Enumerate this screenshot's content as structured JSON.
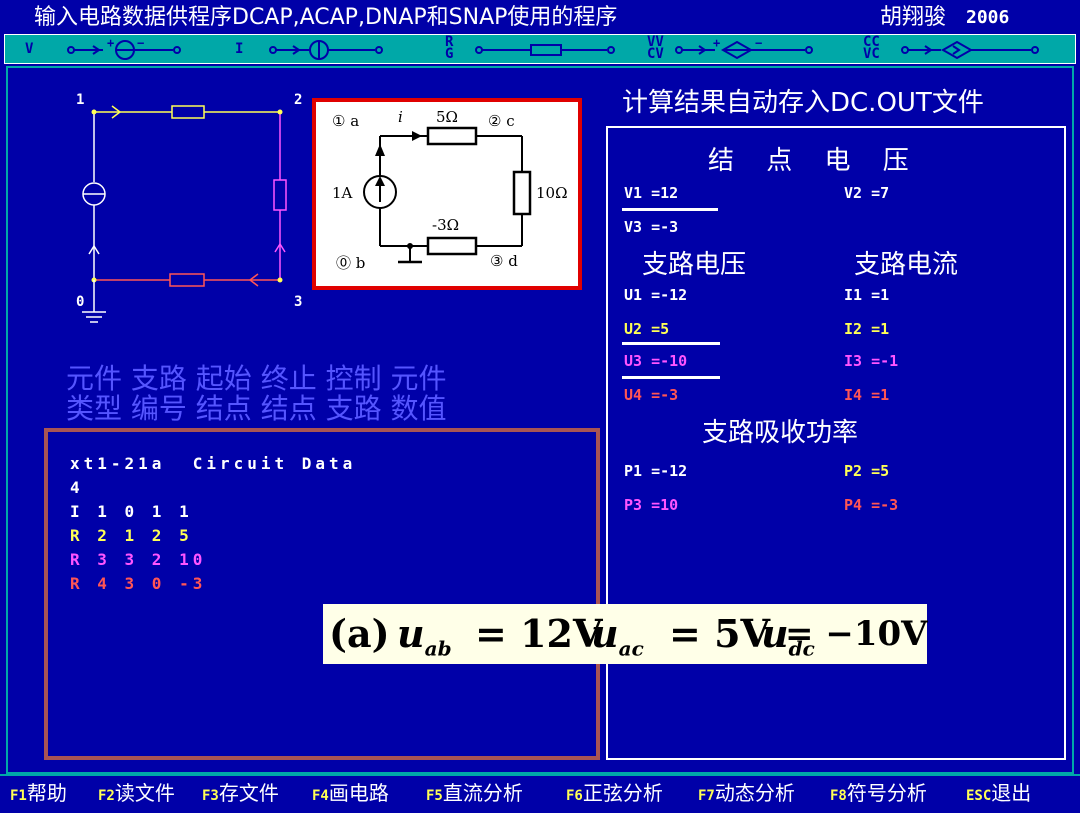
{
  "title": {
    "main": "输入电路数据供程序DCAP,ACAP,DNAP和SNAP使用的程序",
    "author": "胡翔骏",
    "year": "2006"
  },
  "toolbar": {
    "items": [
      {
        "label": "V",
        "icon": "voltage-source-icon"
      },
      {
        "label": "I",
        "icon": "current-source-icon"
      },
      {
        "label": "R\nG",
        "icon": "resistor-icon"
      },
      {
        "label": "VV\nCV",
        "icon": "controlled-voltage-source-icon"
      },
      {
        "label": "CC\nVC",
        "icon": "controlled-current-source-icon"
      }
    ]
  },
  "schematic": {
    "nodes": [
      "1",
      "2",
      "3",
      "0"
    ]
  },
  "circuit_figure": {
    "node_a": "① a",
    "node_c": "② c",
    "node_b": "⓪ b",
    "node_d": "③ d",
    "current": "i",
    "r_top": "5Ω",
    "r_right": "10Ω",
    "r_bottom": "-3Ω",
    "source": "1A"
  },
  "column_headers": {
    "line1": "元件 支路 起始 终止 控制 元件",
    "line2": "类型 编号 结点 结点 支路 数值"
  },
  "circuit_data": {
    "lines": [
      {
        "text": "xt1-21a  Circuit Data",
        "color": "#ffffff"
      },
      {
        "text": "4",
        "color": "#ffffff"
      },
      {
        "text": "I 1 0 1 1",
        "color": "#ffffff"
      },
      {
        "text": "R 2 1 2 5",
        "color": "#ffff55"
      },
      {
        "text": "R 3 3 2 10",
        "color": "#ff55ff"
      },
      {
        "text": "R 4 3 0 -3",
        "color": "#ff5555"
      }
    ]
  },
  "results": {
    "title": "计算结果自动存入DC.OUT文件",
    "node_voltage_title": "结 点 电 压",
    "node_voltages": [
      "V1 =12",
      "V2 =7",
      "V3 =-3"
    ],
    "branch_voltage_title": "支路电压",
    "branch_current_title": "支路电流",
    "branch_voltages": [
      {
        "text": "U1 =-12",
        "color": "#ffffff"
      },
      {
        "text": "U2 =5",
        "color": "#ffff55"
      },
      {
        "text": "U3 =-10",
        "color": "#ff55ff"
      },
      {
        "text": "U4 =-3",
        "color": "#ff5555"
      }
    ],
    "branch_currents": [
      {
        "text": "I1 =1",
        "color": "#ffffff"
      },
      {
        "text": "I2 =1",
        "color": "#ffff55"
      },
      {
        "text": "I3 =-1",
        "color": "#ff55ff"
      },
      {
        "text": "I4 =1",
        "color": "#ff5555"
      }
    ],
    "power_title": "支路吸收功率",
    "powers": [
      {
        "text": "P1 =-12",
        "color": "#ffffff"
      },
      {
        "text": "P2 =5",
        "color": "#ffff55"
      },
      {
        "text": "P3 =10",
        "color": "#ff55ff"
      },
      {
        "text": "P4 =-3",
        "color": "#ff5555"
      }
    ]
  },
  "answer": {
    "prefix": "(a)",
    "u1_var": "u",
    "u1_sub": "ab",
    "u1_val": "= 12V",
    "u2_var": "u",
    "u2_sub": "ac",
    "u2_val": "= 5V",
    "u3_var": "u",
    "u3_sub": "dc",
    "u3_val": "= −10V"
  },
  "function_keys": [
    {
      "key": "F1",
      "label": "帮助"
    },
    {
      "key": "F2",
      "label": "读文件"
    },
    {
      "key": "F3",
      "label": "存文件"
    },
    {
      "key": "F4",
      "label": "画电路"
    },
    {
      "key": "F5",
      "label": "直流分析"
    },
    {
      "key": "F6",
      "label": "正弦分析"
    },
    {
      "key": "F7",
      "label": "动态分析"
    },
    {
      "key": "F8",
      "label": "符号分析"
    },
    {
      "key": "ESC",
      "label": "退出"
    }
  ]
}
